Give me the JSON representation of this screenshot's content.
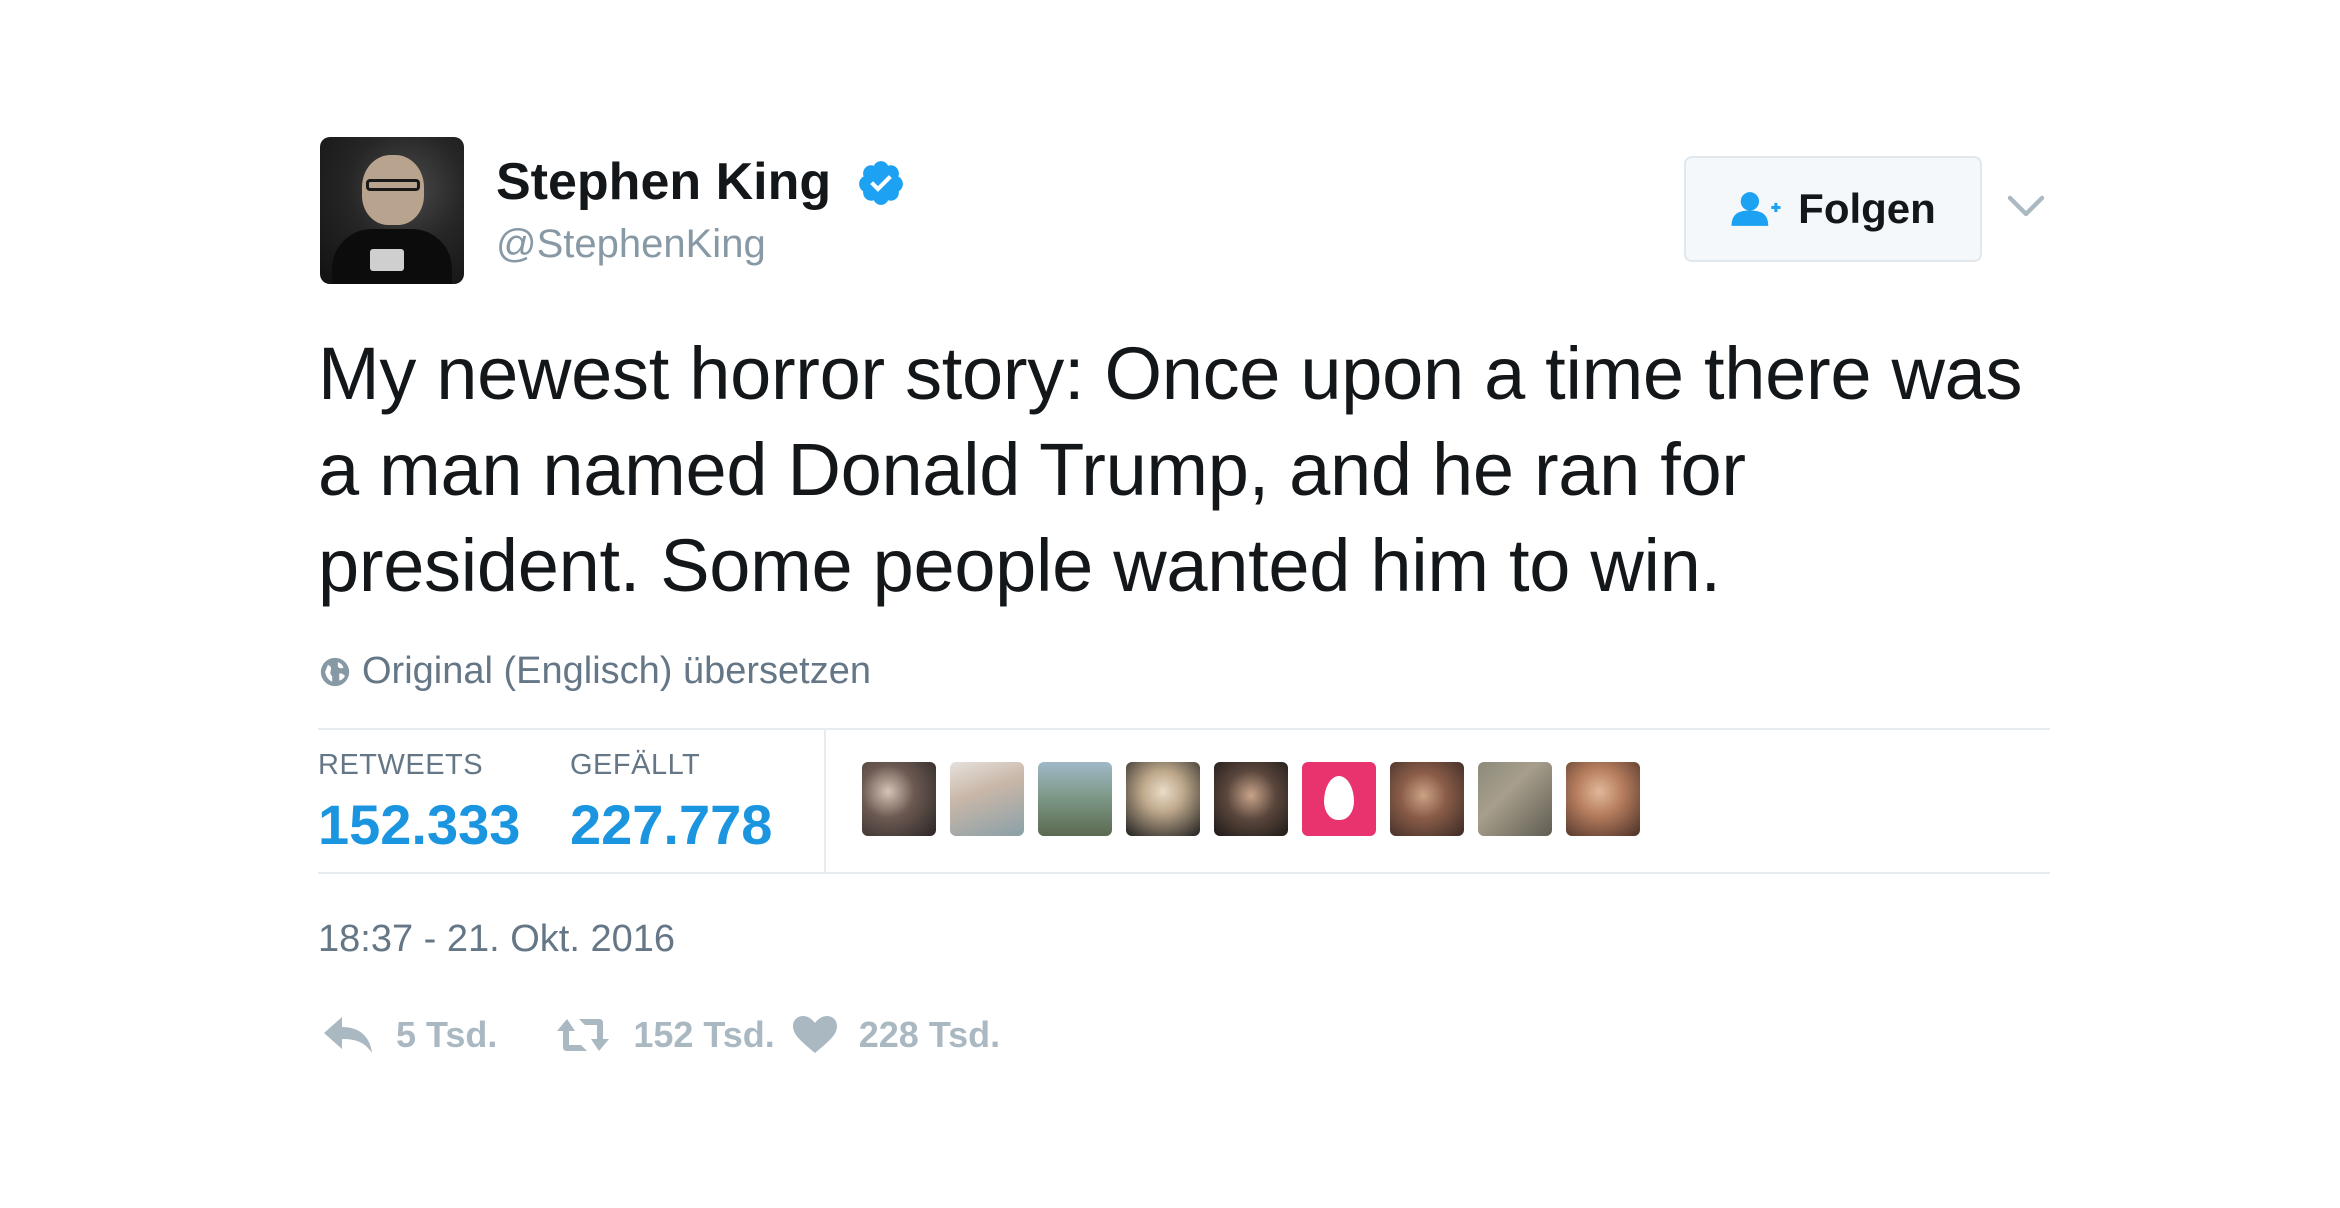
{
  "user": {
    "name": "Stephen King",
    "handle": "@StephenKing",
    "verified": true
  },
  "follow_button": {
    "label": "Folgen",
    "icon": "follow-user-icon"
  },
  "more_menu_icon": "chevron-down-icon",
  "tweet": {
    "text": "My newest horror story: Once upon a time there was a man named Donald Trump, and he ran for president. Some people wanted him to win."
  },
  "translate": {
    "icon": "globe-icon",
    "label": "Original (Englisch) übersetzen"
  },
  "stats": {
    "retweets": {
      "label": "RETWEETS",
      "value": "152.333"
    },
    "likes": {
      "label": "GEFÄLLT",
      "value": "227.778"
    }
  },
  "likers_count": 9,
  "timestamp": "18:37 - 21. Okt. 2016",
  "actions": {
    "reply": {
      "icon": "reply-icon",
      "count": "5 Tsd."
    },
    "retweet": {
      "icon": "retweet-icon",
      "count": "152 Tsd."
    },
    "like": {
      "icon": "heart-icon",
      "count": "228 Tsd."
    }
  },
  "colors": {
    "accent": "#1b95e0",
    "verified": "#1da1f2",
    "text_primary": "#14171a",
    "text_secondary": "#657786",
    "action_gray": "#aab8c2"
  }
}
